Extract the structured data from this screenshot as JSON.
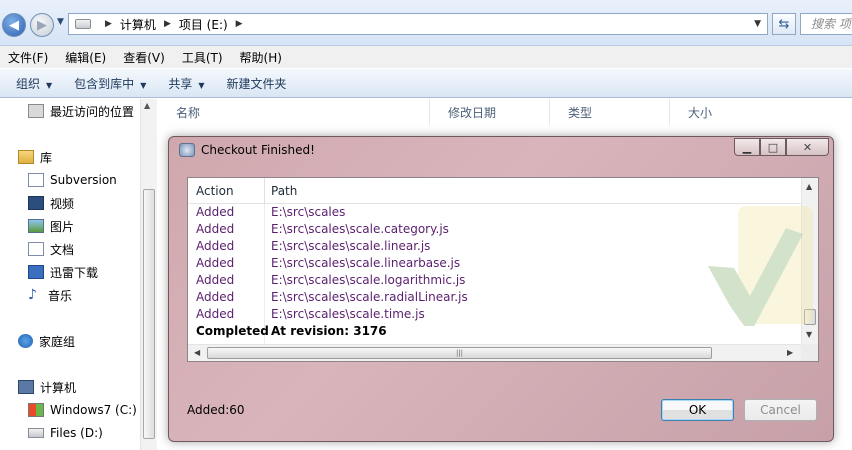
{
  "explorer": {
    "address": [
      "计算机",
      "项目 (E:)"
    ],
    "search_placeholder": "搜索 项目 (E:)",
    "menu": [
      "文件(F)",
      "编辑(E)",
      "查看(V)",
      "工具(T)",
      "帮助(H)"
    ],
    "commands": [
      {
        "label": "组织",
        "dropdown": true
      },
      {
        "label": "包含到库中",
        "dropdown": true
      },
      {
        "label": "共享",
        "dropdown": true
      },
      {
        "label": "新建文件夹",
        "dropdown": false
      }
    ],
    "nav": {
      "recent": "最近访问的位置",
      "libraries": "库",
      "library_items": [
        "Subversion",
        "视频",
        "图片",
        "文档",
        "迅雷下载",
        "音乐"
      ],
      "homegroup": "家庭组",
      "computer": "计算机",
      "drives": [
        "Windows7 (C:)",
        "Files (D:)"
      ]
    },
    "columns": [
      "名称",
      "修改日期",
      "类型",
      "大小"
    ]
  },
  "dialog": {
    "title": "Checkout Finished!",
    "headers": {
      "action": "Action",
      "path": "Path"
    },
    "rows": [
      {
        "action": "Added",
        "path": "E:\\src\\scales"
      },
      {
        "action": "Added",
        "path": "E:\\src\\scales\\scale.category.js"
      },
      {
        "action": "Added",
        "path": "E:\\src\\scales\\scale.linear.js"
      },
      {
        "action": "Added",
        "path": "E:\\src\\scales\\scale.linearbase.js"
      },
      {
        "action": "Added",
        "path": "E:\\src\\scales\\scale.logarithmic.js"
      },
      {
        "action": "Added",
        "path": "E:\\src\\scales\\scale.radialLinear.js"
      },
      {
        "action": "Added",
        "path": "E:\\src\\scales\\scale.time.js"
      },
      {
        "action": "Completed",
        "path": "At revision: 3176"
      }
    ],
    "status": "Added:60",
    "ok": "OK",
    "cancel": "Cancel",
    "colors": {
      "added": "#5a1f6e",
      "ok_border": "#3c7fb1"
    }
  }
}
